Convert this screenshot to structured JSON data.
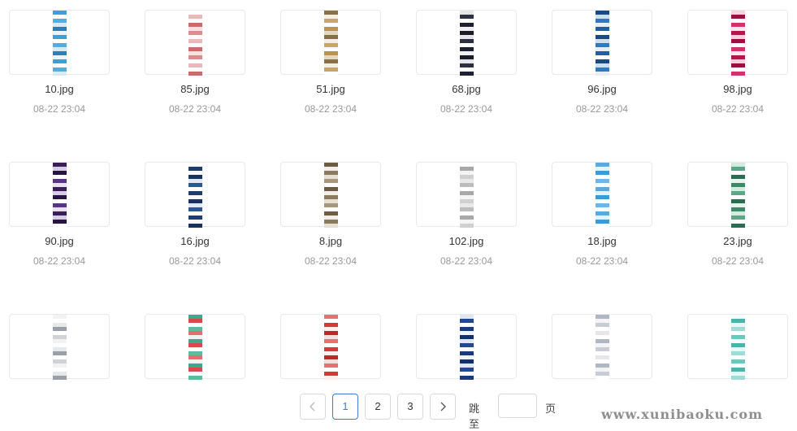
{
  "files": [
    {
      "name": "10.jpg",
      "date": "08-22 23:04",
      "colors": [
        "#3aa0d8",
        "#e8f3fa",
        "#2a7fb8",
        "#d6ebf6",
        "#4db0e0",
        "#ffffff"
      ]
    },
    {
      "name": "85.jpg",
      "date": "08-22 23:04",
      "colors": [
        "#e8b9b9",
        "#ffffff",
        "#d98c8c",
        "#f5e3e3",
        "#c96b6b",
        "#fafafa"
      ]
    },
    {
      "name": "51.jpg",
      "date": "08-22 23:04",
      "colors": [
        "#c9a56a",
        "#f4efe6",
        "#8a7048",
        "#e6d8be",
        "#b8944f",
        "#ffffff"
      ]
    },
    {
      "name": "68.jpg",
      "date": "08-22 23:04",
      "colors": [
        "#1e2230",
        "#ffffff",
        "#2c3040",
        "#e5e6e8",
        "#1a1d28",
        "#f0f0f2"
      ]
    },
    {
      "name": "96.jpg",
      "date": "08-22 23:04",
      "colors": [
        "#1f5fa8",
        "#e6eef8",
        "#2f78c4",
        "#cfdff2",
        "#174a86",
        "#ffffff"
      ]
    },
    {
      "name": "98.jpg",
      "date": "08-22 23:04",
      "colors": [
        "#b0184a",
        "#fde8ef",
        "#d4306a",
        "#ffffff",
        "#9a1040",
        "#f6d2de"
      ]
    },
    {
      "name": "90.jpg",
      "date": "08-22 23:04",
      "colors": [
        "#3a1e5a",
        "#e8e2f0",
        "#5a3484",
        "#ffffff",
        "#2a1444",
        "#d6cce4"
      ]
    },
    {
      "name": "16.jpg",
      "date": "08-22 23:04",
      "colors": [
        "#1d3d6e",
        "#ffffff",
        "#2a5596",
        "#e2e8f2",
        "#183260",
        "#f6f8fb"
      ]
    },
    {
      "name": "8.jpg",
      "date": "08-22 23:04",
      "colors": [
        "#8a7a5e",
        "#f2efe8",
        "#6b5c44",
        "#ffffff",
        "#a8977a",
        "#e6e0d2"
      ]
    },
    {
      "name": "102.jpg",
      "date": "08-22 23:04",
      "colors": [
        "#d0d0d0",
        "#f4f4f4",
        "#a8a8a8",
        "#ffffff",
        "#bcbcbc",
        "#e8e8e8"
      ]
    },
    {
      "name": "18.jpg",
      "date": "08-22 23:04",
      "colors": [
        "#6fb6e8",
        "#ffffff",
        "#3d9ad8",
        "#e4f2fb",
        "#5aaae0",
        "#f6fbfe"
      ]
    },
    {
      "name": "23.jpg",
      "date": "08-22 23:04",
      "colors": [
        "#3a8a6a",
        "#e8f4ee",
        "#2a6e52",
        "#ffffff",
        "#5aa888",
        "#d4ece0"
      ]
    },
    {
      "name": "",
      "date": "",
      "colors": [
        "#f2f2f2",
        "#cfd3d8",
        "#ffffff",
        "#9aa0a8",
        "#e6e8ea",
        "#ffffff"
      ]
    },
    {
      "name": "",
      "date": "",
      "colors": [
        "#d64a4a",
        "#3aaa8a",
        "#f2f2f2",
        "#e07070",
        "#5abba0",
        "#ffffff"
      ]
    },
    {
      "name": "",
      "date": "",
      "colors": [
        "#d43a3a",
        "#ffffff",
        "#e87070",
        "#f6dede",
        "#c02828",
        "#fbeeee"
      ]
    },
    {
      "name": "",
      "date": "",
      "colors": [
        "#1a3a7a",
        "#ffffff",
        "#24488e",
        "#e0e6f2",
        "#12306a",
        "#f0f3f9"
      ]
    },
    {
      "name": "",
      "date": "",
      "colors": [
        "#e6e6ea",
        "#ffffff",
        "#c8ccd4",
        "#f4f4f6",
        "#b0b6c2",
        "#ffffff"
      ]
    },
    {
      "name": "",
      "date": "",
      "colors": [
        "#6ac8c0",
        "#ffffff",
        "#a0dcd6",
        "#eaf7f6",
        "#4ab4aa",
        "#f6fbfb"
      ]
    }
  ],
  "pagination": {
    "prev_icon": "chevron-left-icon",
    "next_icon": "chevron-right-icon",
    "pages": [
      "1",
      "2",
      "3"
    ],
    "active_page": "1",
    "jump_label": "跳至",
    "jump_value": "",
    "page_suffix": "页"
  },
  "watermark": "www.xunibaoku.com",
  "colors": {
    "accent": "#3b7be0",
    "border": "#e6e9ee",
    "date_text": "#999999"
  }
}
